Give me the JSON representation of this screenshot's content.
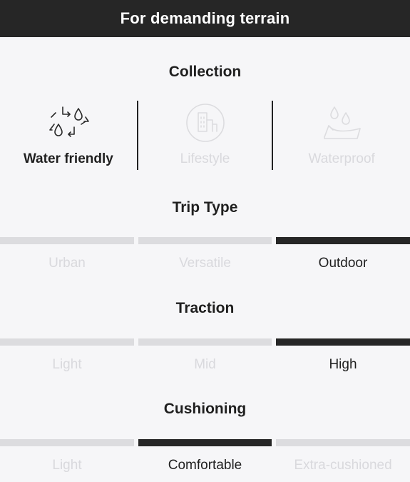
{
  "header": {
    "title": "For demanding terrain"
  },
  "collection": {
    "title": "Collection",
    "items": [
      {
        "label": "Water friendly",
        "icon": "water-friendly-icon",
        "active": true
      },
      {
        "label": "Lifestyle",
        "icon": "city-building-icon",
        "active": false
      },
      {
        "label": "Waterproof",
        "icon": "waterproof-icon",
        "active": false
      }
    ]
  },
  "trip_type": {
    "title": "Trip Type",
    "options": [
      "Urban",
      "Versatile",
      "Outdoor"
    ],
    "selected": "Outdoor"
  },
  "traction": {
    "title": "Traction",
    "options": [
      "Light",
      "Mid",
      "High"
    ],
    "selected": "High"
  },
  "cushioning": {
    "title": "Cushioning",
    "options": [
      "Light",
      "Comfortable",
      "Extra-cushioned"
    ],
    "selected": "Comfortable"
  },
  "colors": {
    "header_bg": "#262626",
    "active": "#262626",
    "inactive_bar": "#dcdcdf",
    "inactive_text": "#d9d9dd",
    "background": "#f6f6f8"
  }
}
